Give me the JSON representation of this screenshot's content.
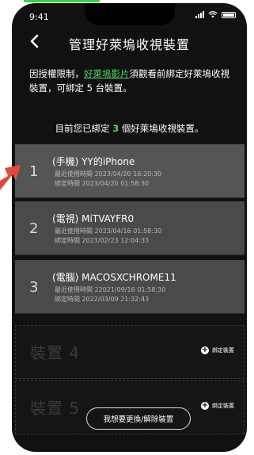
{
  "status_bar": {
    "time": "9:41"
  },
  "nav": {
    "title": "管理好萊塢收視裝置"
  },
  "notice": {
    "prefix": "因授權限制，",
    "link": "好萊塢影片",
    "suffix": "須觀看前綁定好萊塢收視裝置，可綁定 5 台裝置。"
  },
  "summary": {
    "prefix": "目前您已綁定 ",
    "count": "3",
    "suffix": " 個好萊塢收視裝置。"
  },
  "devices": [
    {
      "index": "1",
      "name": "(手機) YY的iPhone",
      "last_used": "最近使用時間  2023/04/20  16:20:30",
      "bound": "綁定時間  2023/04/20  01:58:30"
    },
    {
      "index": "2",
      "name": "(電視) MiTVAYFR0",
      "last_used": "最近使用時間  2023/04/16  01:58:30",
      "bound": "綁定時間  2023/02/23  12:04:33"
    },
    {
      "index": "3",
      "name": "(電腦) MACOSXCHROME11",
      "last_used": "最近使用時間  22021/09/16  01:58:30",
      "bound": "綁定時間  2022/03/09  21:32:43"
    }
  ],
  "slots": [
    {
      "label": "裝置 4",
      "bind_label": "綁定裝置"
    },
    {
      "label": "裝置 5",
      "bind_label": "綁定裝置"
    }
  ],
  "manage_button": "我想要更換/解除裝置",
  "colors": {
    "accent": "#4cd964",
    "background": "#111111",
    "arrow": "#e2483b"
  }
}
